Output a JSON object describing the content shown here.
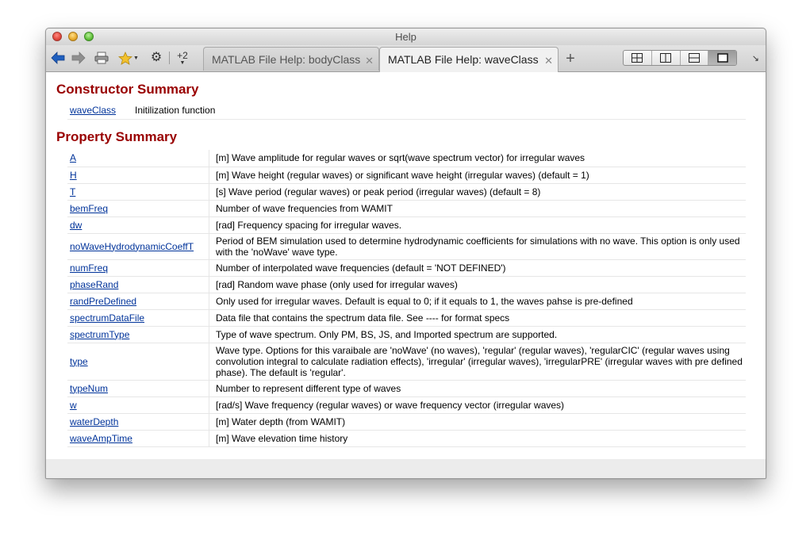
{
  "window": {
    "title": "Help"
  },
  "toolbar": {
    "back_icon": "back-arrow-icon",
    "forward_icon": "forward-arrow-icon",
    "print_icon": "print-icon",
    "favorites_icon": "star-icon",
    "settings_icon": "gear-icon",
    "zoom_label": "+2"
  },
  "tabs": [
    {
      "label": "MATLAB File Help: bodyClass",
      "active": false,
      "close": "✕"
    },
    {
      "label": "MATLAB File Help: waveClass",
      "active": true,
      "close": "✕"
    }
  ],
  "new_tab_label": "+",
  "constructor_summary": {
    "heading": "Constructor Summary",
    "name": "waveClass",
    "description": "Initilization function"
  },
  "property_summary": {
    "heading": "Property Summary",
    "rows": [
      {
        "name": "A",
        "description": "[m] Wave amplitude for regular waves or sqrt(wave spectrum vector) for irregular waves"
      },
      {
        "name": "H",
        "description": "[m] Wave height (regular waves) or significant wave height (irregular waves) (default = 1)"
      },
      {
        "name": "T",
        "description": "[s] Wave period (regular waves) or peak period (irregular waves) (default = 8)"
      },
      {
        "name": "bemFreq",
        "description": "Number of wave frequencies from WAMIT"
      },
      {
        "name": "dw",
        "description": "[rad] Frequency spacing for irregular waves."
      },
      {
        "name": "noWaveHydrodynamicCoeffT",
        "description": "Period of BEM simulation used to determine hydrodynamic coefficients for simulations with no wave. This option is only used with the 'noWave' wave type."
      },
      {
        "name": "numFreq",
        "description": "Number of interpolated wave frequencies (default = 'NOT DEFINED')"
      },
      {
        "name": "phaseRand",
        "description": "[rad] Random wave phase (only used for irregular waves)"
      },
      {
        "name": "randPreDefined",
        "description": "Only used for irregular waves. Default is equal to 0; if it equals to 1, the waves pahse is pre-defined"
      },
      {
        "name": "spectrumDataFile",
        "description": "Data file that contains the spectrum data file. See ---- for format specs"
      },
      {
        "name": "spectrumType",
        "description": "Type of wave spectrum. Only PM, BS, JS, and Imported spectrum are supported."
      },
      {
        "name": "type",
        "description": "Wave type. Options for this varaibale are 'noWave' (no waves), 'regular' (regular waves), 'regularCIC' (regular waves using convolution integral to calculate radiation effects), 'irregular' (irregular waves), 'irregularPRE' (irregular waves with pre defined phase). The default is 'regular'."
      },
      {
        "name": "typeNum",
        "description": "Number to represent different type of waves"
      },
      {
        "name": "w",
        "description": "[rad/s] Wave frequency (regular waves) or wave frequency vector (irregular waves)"
      },
      {
        "name": "waterDepth",
        "description": "[m] Water depth (from WAMIT)"
      },
      {
        "name": "waveAmpTime",
        "description": "[m] Wave elevation time history"
      }
    ]
  },
  "colors": {
    "heading": "#990000",
    "link": "#00339a"
  }
}
